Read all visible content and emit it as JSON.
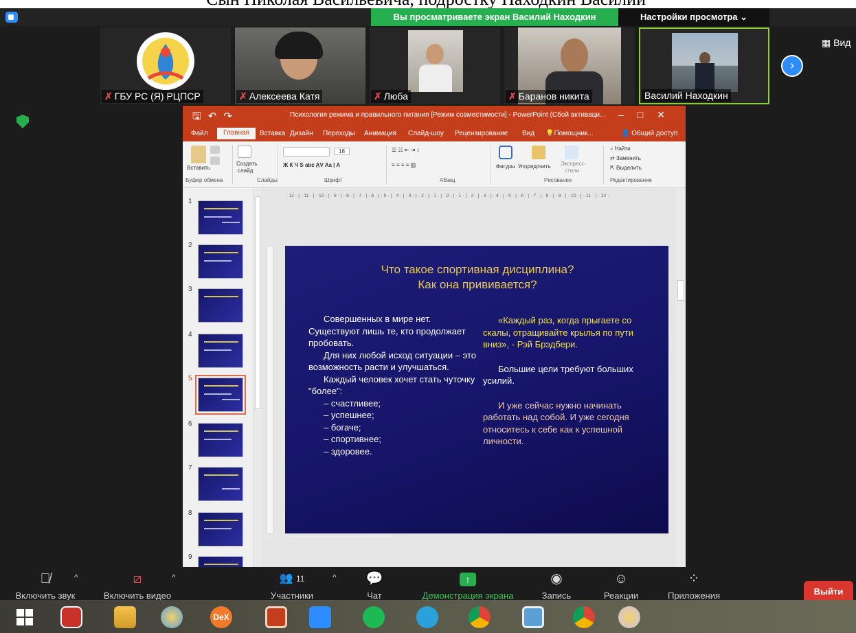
{
  "caption": {
    "text": "Сын Николая Васильевича, подростку Находкин Василий"
  },
  "zoom": {
    "share_banner": "Вы просматриваете экран Василий Находкин",
    "view_settings": "Настройки просмотра ⌄",
    "view_button": "Вид",
    "participants": [
      {
        "name": "ГБУ РС (Я) РЦПСР",
        "muted": true
      },
      {
        "name": "Алексеева Катя",
        "muted": true
      },
      {
        "name": "Люба",
        "muted": true
      },
      {
        "name": "Баранов никита",
        "muted": true
      },
      {
        "name": "Василий Находкин",
        "muted": false,
        "active": true
      }
    ],
    "toolbar": {
      "unmute": "Включить звук",
      "start_video": "Включить видео",
      "participants": "Участники",
      "participants_count": "11",
      "chat": "Чат",
      "share": "Демонстрация экрана",
      "record": "Запись",
      "reactions": "Реакции",
      "apps": "Приложения",
      "leave": "Выйти"
    }
  },
  "powerpoint": {
    "title": "Психология режима и правильного питания [Режим совместимости] - PowerPoint (Сбой активаци...",
    "tabs": [
      "Файл",
      "Главная",
      "Вставка",
      "Дизайн",
      "Переходы",
      "Анимация",
      "Слайд-шоу",
      "Рецензирование",
      "Вид",
      "Помощник..."
    ],
    "active_tab": "Главная",
    "share_label": "Общий доступ",
    "ribbon": {
      "paste": "Вставить",
      "create_slide": "Создать",
      "create_slide_2": "слайд",
      "font_size": "18",
      "shapes": "Фигуры",
      "arrange": "Упорядочить",
      "express": "Экспресс-",
      "express_2": "стили",
      "find": "Найти",
      "replace": "Заменить",
      "select": "Выделить",
      "groups": {
        "clipboard": "Буфер обмена",
        "slides": "Слайды",
        "font": "Шрифт",
        "paragraph": "Абзац",
        "drawing": "Рисование",
        "editing": "Редактирование"
      }
    },
    "ruler_h": "· 12 · | · 11 · | · 10 · | · 9 · | · 8 · | · 7 · | · 6 · | · 5 · | · 4 · | · 3 · | · 2 · | · 1 · | · 0 · | · 1 · | · 2 · | · 3 · | · 4 · | · 5 · | · 6 · | · 7 · | · 8 · | · 9 · | · 10 · | · 11 · | · 12 ·",
    "thumb_numbers": [
      "1",
      "2",
      "3",
      "4",
      "5",
      "6",
      "7",
      "8",
      "9"
    ],
    "selected_slide": 5
  },
  "slide": {
    "title_line1": "Что такое спортивная дисциплина?",
    "title_line2": "Как она прививается?",
    "left": {
      "p1a": "Совершенных в мире нет.",
      "p1b": "Существуют лишь те, кто продолжает пробовать.",
      "p2": "Для них любой исход ситуации – это возможность расти и улучшаться.",
      "p3": "Каждый человек хочет стать чуточку \"более\":",
      "items": [
        "– счастливее;",
        "– успешнее;",
        "– богаче;",
        "– спортивнее;",
        "– здоровее."
      ]
    },
    "right": {
      "quote": "«Каждый раз, когда прыгаете со скалы, отращивайте крылья по пути вниз», - Рэй Брэдбери.",
      "p2": "Большие цели требуют больших усилий.",
      "p3": "И уже сейчас нужно начинать работать над собой. И уже сегодня относитесь к себе как к успешной личности."
    }
  },
  "colors": {
    "zoom_bg": "#1c1c1c",
    "share_green": "#27ae4f",
    "ppt_red": "#c43e1c",
    "slide_title": "#e9c94a",
    "leave_red": "#d9362d"
  },
  "taskbar": {
    "apps": [
      "windows-start",
      "power-app",
      "file-explorer",
      "paint-app",
      "dex-app",
      "presentation-app",
      "zoom-app",
      "spotify",
      "telegram",
      "chrome",
      "calculator",
      "chrome",
      "paint-app"
    ]
  }
}
